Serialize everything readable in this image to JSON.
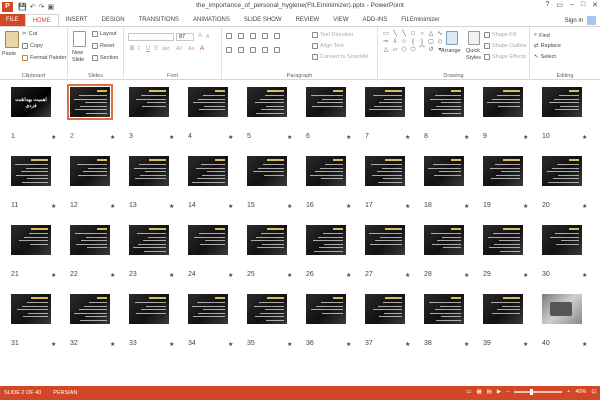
{
  "window": {
    "title": "the_importance_of_personal_hygiene(FILEminimizer).pptx - PowerPoint",
    "qat": [
      "💾",
      "↶",
      "↷",
      "▣"
    ],
    "controls": [
      "?",
      "▭",
      "–",
      "□",
      "✕"
    ]
  },
  "tabs": [
    {
      "label": "FILE",
      "kind": "file"
    },
    {
      "label": "HOME",
      "kind": "active"
    },
    {
      "label": "INSERT"
    },
    {
      "label": "DESIGN"
    },
    {
      "label": "TRANSITIONS"
    },
    {
      "label": "ANIMATIONS"
    },
    {
      "label": "SLIDE SHOW"
    },
    {
      "label": "REVIEW"
    },
    {
      "label": "VIEW"
    },
    {
      "label": "ADD-INS"
    },
    {
      "label": "FILEminimizer"
    }
  ],
  "signin": "Sign in",
  "ribbon": {
    "clipboard": {
      "label": "Clipboard",
      "paste": "Paste",
      "cut": "Cut",
      "copy": "Copy",
      "format_painter": "Format Painter"
    },
    "slides": {
      "label": "Slides",
      "new_slide": "New",
      "new_slide2": "Slide",
      "layout": "Layout",
      "reset": "Reset",
      "section": "Section"
    },
    "font": {
      "label": "Font",
      "size": "87",
      "bold": "B",
      "italic": "I",
      "underline": "U",
      "strike": "S",
      "shadow": "abc",
      "spacing": "AV",
      "case": "Aa",
      "color": "A"
    },
    "paragraph": {
      "label": "Paragraph",
      "text_direction": "Text Direction",
      "align_text": "Align Text",
      "smartart": "Convert to SmartArt"
    },
    "drawing": {
      "label": "Drawing",
      "arrange": "Arrange",
      "quick_styles": "Quick",
      "quick_styles2": "Styles",
      "shape_fill": "Shape Fill",
      "shape_outline": "Shape Outline",
      "shape_effects": "Shape Effects"
    },
    "editing": {
      "label": "Editing",
      "find": "Find",
      "replace": "Replace",
      "select": "Select"
    }
  },
  "slides": {
    "selected": 2,
    "count": 40,
    "first_title": "اهمیت بهداشت فردی",
    "numbers": [
      "1",
      "2",
      "3",
      "4",
      "5",
      "6",
      "7",
      "8",
      "9",
      "10",
      "11",
      "12",
      "13",
      "14",
      "15",
      "16",
      "17",
      "18",
      "19",
      "20",
      "21",
      "22",
      "23",
      "24",
      "25",
      "26",
      "27",
      "28",
      "29",
      "30",
      "31",
      "32",
      "33",
      "34",
      "35",
      "36",
      "37",
      "38",
      "39",
      "40"
    ],
    "star": "★"
  },
  "status": {
    "slide_info": "SLIDE 2 OF 40",
    "language": "PERSIAN",
    "zoom": "40%",
    "zoom_minus": "–",
    "zoom_plus": "+"
  },
  "colors": {
    "accent": "#d24726",
    "selection": "#e07040"
  }
}
